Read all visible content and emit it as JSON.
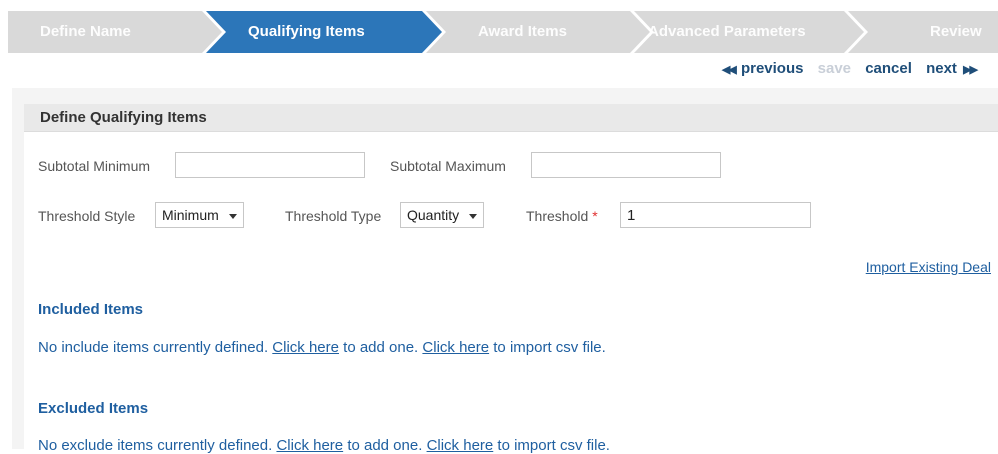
{
  "wizard": {
    "steps": [
      {
        "label": "Define Name",
        "state": "inactive"
      },
      {
        "label": "Qualifying Items",
        "state": "active"
      },
      {
        "label": "Award Items",
        "state": "inactive"
      },
      {
        "label": "Advanced Parameters",
        "state": "inactive"
      },
      {
        "label": "Review",
        "state": "inactive"
      }
    ],
    "colors": {
      "inactive": "#d9d9d9",
      "active": "#2c76b9"
    }
  },
  "nav": {
    "previous": "previous",
    "save": "save",
    "cancel": "cancel",
    "next": "next"
  },
  "section": {
    "title": "Define Qualifying Items"
  },
  "form": {
    "subtotal_min_label": "Subtotal Minimum",
    "subtotal_min_value": "",
    "subtotal_max_label": "Subtotal Maximum",
    "subtotal_max_value": "",
    "threshold_style_label": "Threshold Style",
    "threshold_style_value": "Minimum",
    "threshold_type_label": "Threshold Type",
    "threshold_type_value": "Quantity",
    "threshold_label": "Threshold",
    "threshold_required": "*",
    "threshold_value": "1"
  },
  "import_existing": "Import Existing Deal",
  "included": {
    "title": "Included Items",
    "text_before": "No include items currently defined.",
    "link1": "Click here",
    "text_mid": "to add one.",
    "link2": "Click here",
    "text_after": "to import csv file."
  },
  "excluded": {
    "title": "Excluded Items",
    "text_before": "No exclude items currently defined.",
    "link1": "Click here",
    "text_mid": "to add one.",
    "link2": "Click here",
    "text_after": "to import csv file."
  }
}
